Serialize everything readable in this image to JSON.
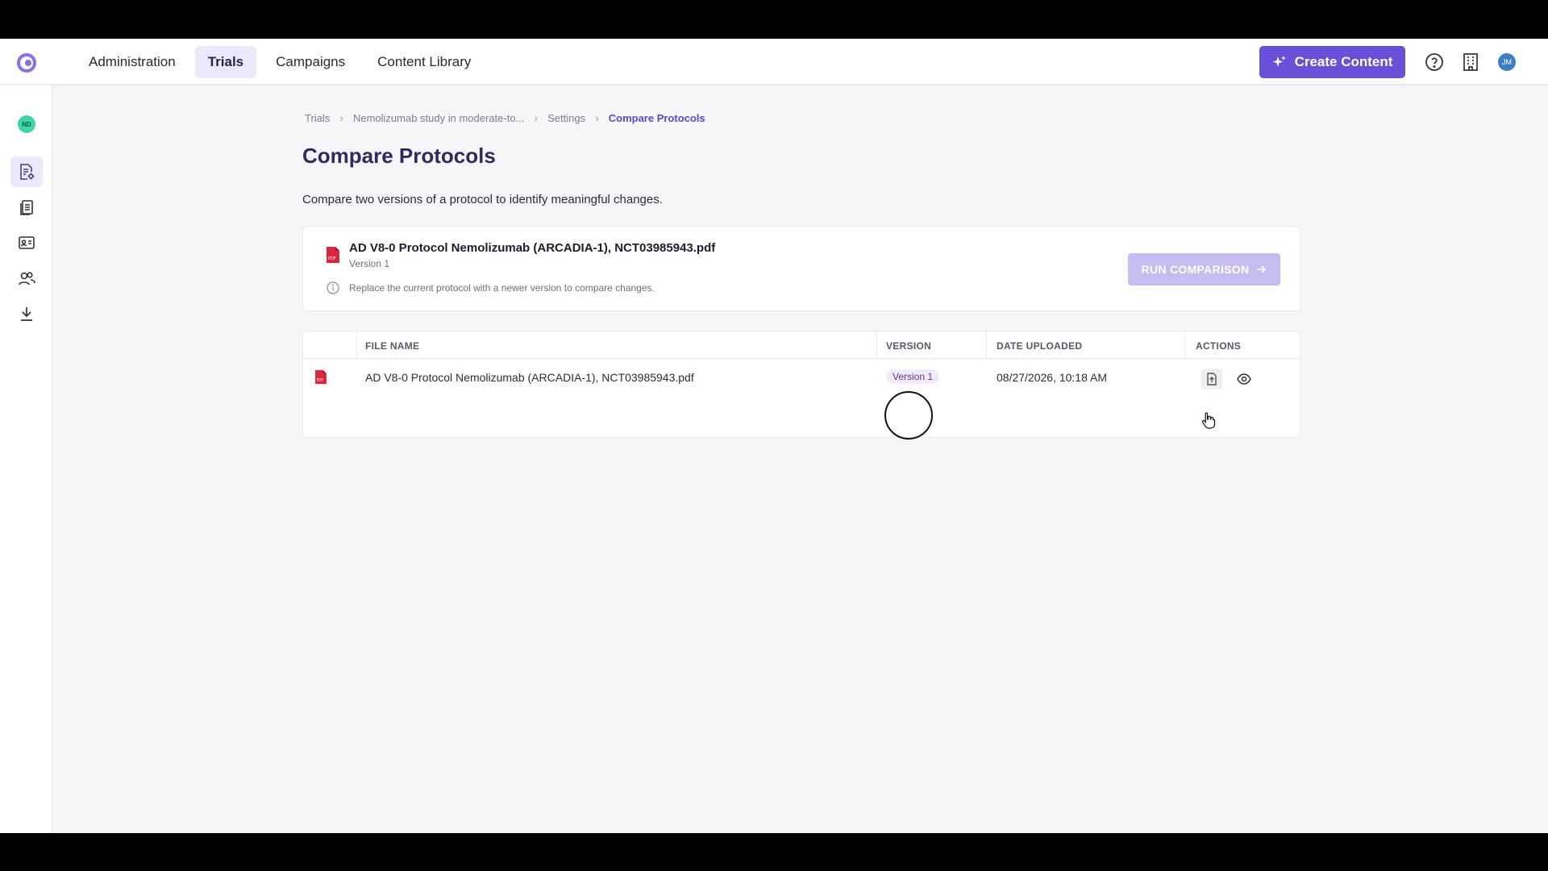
{
  "nav": {
    "items": [
      {
        "label": "Administration",
        "active": false
      },
      {
        "label": "Trials",
        "active": true
      },
      {
        "label": "Campaigns",
        "active": false
      },
      {
        "label": "Content Library",
        "active": false
      }
    ],
    "create_label": "Create Content",
    "user_initials": "JM",
    "brand_color": "#6a4fd8"
  },
  "sidebar": {
    "avatar_initials": "ND",
    "icons": [
      "trial-settings-icon",
      "clipboard-copy-icon",
      "id-card-icon",
      "users-icon",
      "download-icon"
    ]
  },
  "breadcrumb": {
    "items": [
      "Trials",
      "Nemolizumab study in moderate-to...",
      "Settings"
    ],
    "current": "Compare Protocols"
  },
  "page": {
    "title": "Compare Protocols",
    "subtitle": "Compare two versions of a protocol to identify meaningful changes."
  },
  "protocol_card": {
    "filename": "AD V8-0 Protocol Nemolizumab (ARCADIA-1), NCT03985943.pdf",
    "version": "Version 1",
    "info": "Replace the current protocol with a newer version to compare changes.",
    "run_label": "RUN COMPARISON"
  },
  "table": {
    "headers": {
      "file_name": "FILE NAME",
      "version": "VERSION",
      "date_uploaded": "DATE UPLOADED",
      "actions": "ACTIONS"
    },
    "rows": [
      {
        "file_name": "AD V8-0 Protocol Nemolizumab (ARCADIA-1), NCT03985943.pdf",
        "version": "Version 1",
        "date_uploaded": "08/27/2026, 10:18 AM"
      }
    ]
  }
}
